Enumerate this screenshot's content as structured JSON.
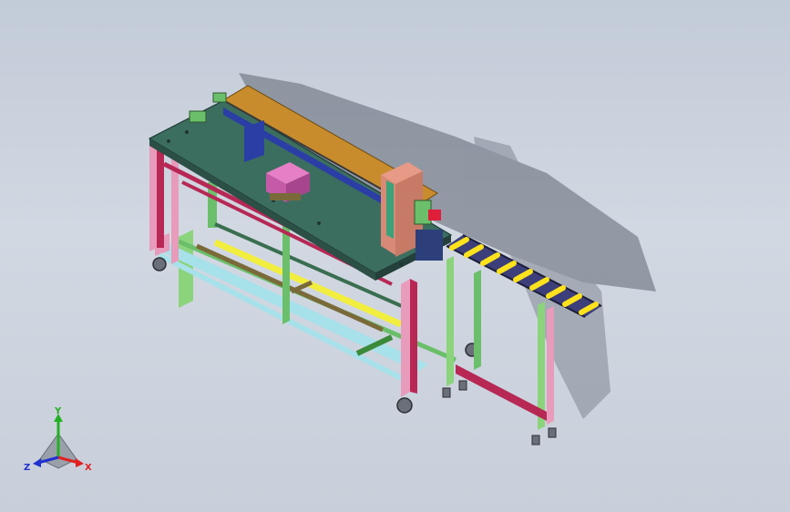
{
  "viewport": {
    "colors": {
      "background_top": "#c2cbd8",
      "background_bottom": "#c8cfda",
      "shadow": "#5f6673",
      "table_top": "#3c6e60",
      "frame_pink": "#e89bbb",
      "frame_red": "#b72855",
      "frame_green": "#6bbf6a",
      "frame_lightblue": "#a7e1ea",
      "rail_yellow": "#f2ee3e",
      "rail_brown": "#7a6a3a",
      "belt_orange": "#c98c2c",
      "belt_blue": "#2a3ea6",
      "block_pink": "#e67fc6",
      "column_salmon": "#e79a86",
      "column_green": "#3ba27a",
      "roller_yellow": "#ffe21c",
      "conveyor_dark": "#3d3f7a",
      "stand_lime": "#8bd47c"
    }
  },
  "triad": {
    "icon": "coordinate-triad-icon",
    "x_label": "X",
    "y_label": "Y",
    "z_label": "Z",
    "x_color": "#e02020",
    "y_color": "#23b023",
    "z_color": "#2030d0"
  }
}
